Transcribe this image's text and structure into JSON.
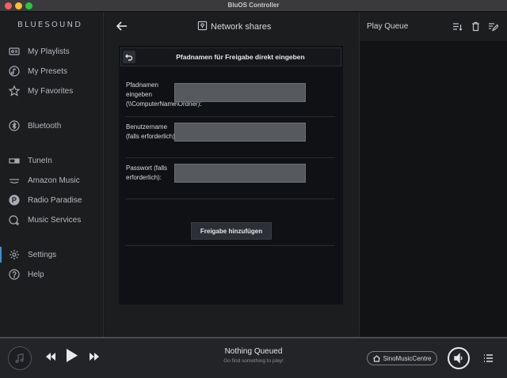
{
  "window": {
    "title": "BluOS Controller"
  },
  "sidebar": {
    "logo": "BLUESOUND",
    "items": [
      {
        "label": "My Playlists",
        "icon": "playlist-icon"
      },
      {
        "label": "My Presets",
        "icon": "preset-icon"
      },
      {
        "label": "My Favorites",
        "icon": "star-icon"
      },
      {
        "label": "Bluetooth",
        "icon": "bluetooth-icon"
      },
      {
        "label": "TuneIn",
        "icon": "tunein-icon"
      },
      {
        "label": "Amazon Music",
        "icon": "amazon-music-icon"
      },
      {
        "label": "Radio Paradise",
        "icon": "radio-paradise-icon"
      },
      {
        "label": "Music Services",
        "icon": "music-services-icon"
      },
      {
        "label": "Settings",
        "icon": "gear-icon",
        "active": true
      },
      {
        "label": "Help",
        "icon": "help-icon"
      }
    ]
  },
  "main": {
    "title": "Network shares",
    "panel": {
      "title": "Pfadnamen für Freigabe direkt eingeben",
      "fields": [
        {
          "label": "Pfadnamen eingeben (\\\\ComputerName\\Ordner):",
          "value": ""
        },
        {
          "label": "Benutzername (falls erforderlich):",
          "value": ""
        },
        {
          "label": "Passwort (falls erforderlich):",
          "value": ""
        }
      ],
      "submit_label": "Freigabe hinzufügen"
    }
  },
  "queue": {
    "title": "Play Queue"
  },
  "player": {
    "now_title": "Nothing Queued",
    "now_subtitle": "Go find something to play!",
    "device": "SinoMusicCentre"
  },
  "colors": {
    "accent": "#3f8fd6",
    "background": "#1c1d1f"
  }
}
